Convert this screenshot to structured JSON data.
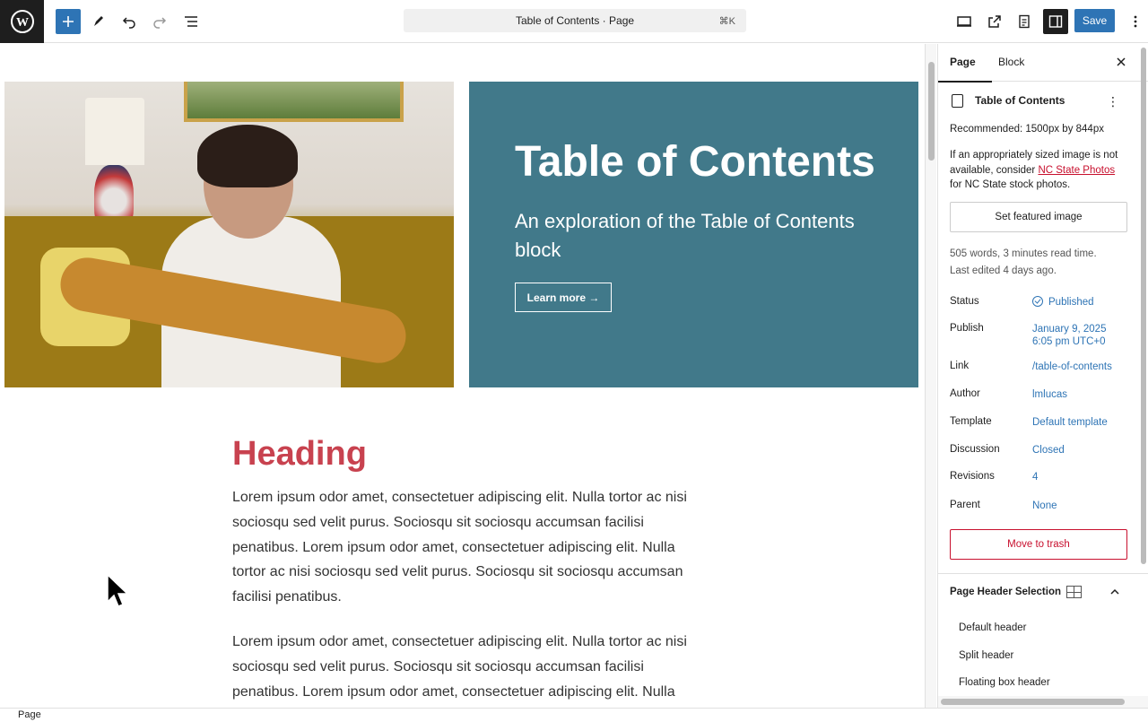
{
  "toolbar": {
    "command_text": "Table of Contents · Page",
    "command_shortcut": "⌘K",
    "save_label": "Save"
  },
  "hero": {
    "title": "Table of Contents",
    "subtitle": "An exploration of the Table of Contents block",
    "button": "Learn more →"
  },
  "content": {
    "heading": "Heading",
    "para1": "Lorem ipsum odor amet, consectetuer adipiscing elit. Nulla tortor ac nisi sociosqu sed velit purus. Sociosqu sit sociosqu accumsan facilisi penatibus. Lorem ipsum odor amet, consectetuer adipiscing elit. Nulla tortor ac nisi sociosqu sed velit purus. Sociosqu sit sociosqu accumsan facilisi penatibus.",
    "para2": "Lorem ipsum odor amet, consectetuer adipiscing elit. Nulla tortor ac nisi sociosqu sed velit purus. Sociosqu sit sociosqu accumsan facilisi penatibus. Lorem ipsum odor amet, consectetuer adipiscing elit. Nulla tortor"
  },
  "sidebar": {
    "tabs": [
      "Page",
      "Block"
    ],
    "doc_title": "Table of Contents",
    "recommended": "Recommended: 1500px by 844px",
    "note_pre": "If an appropriately sized image is not available, consider ",
    "note_link": "NC State Photos",
    "note_post": " for NC State stock photos.",
    "featured_button": "Set featured image",
    "stats_words": "505 words, 3 minutes read time.",
    "stats_edited": "Last edited 4 days ago.",
    "meta": [
      {
        "label": "Status",
        "value": "Published"
      },
      {
        "label": "Publish",
        "value": "January 9, 2025"
      },
      {
        "label": "Link",
        "value": "/table-of-contents"
      },
      {
        "label": "Author",
        "value": "lmlucas"
      },
      {
        "label": "Template",
        "value": "Default template"
      },
      {
        "label": "Discussion",
        "value": "Closed"
      },
      {
        "label": "Revisions",
        "value": "4"
      },
      {
        "label": "Parent",
        "value": "None"
      }
    ],
    "publish_time": "6:05 pm UTC+0",
    "trash_button": "Move to trash",
    "header_selection_title": "Page Header Selection",
    "header_options": [
      "Default header",
      "Split header",
      "Floating box header"
    ]
  },
  "footer": {
    "breadcrumb": "Page"
  }
}
